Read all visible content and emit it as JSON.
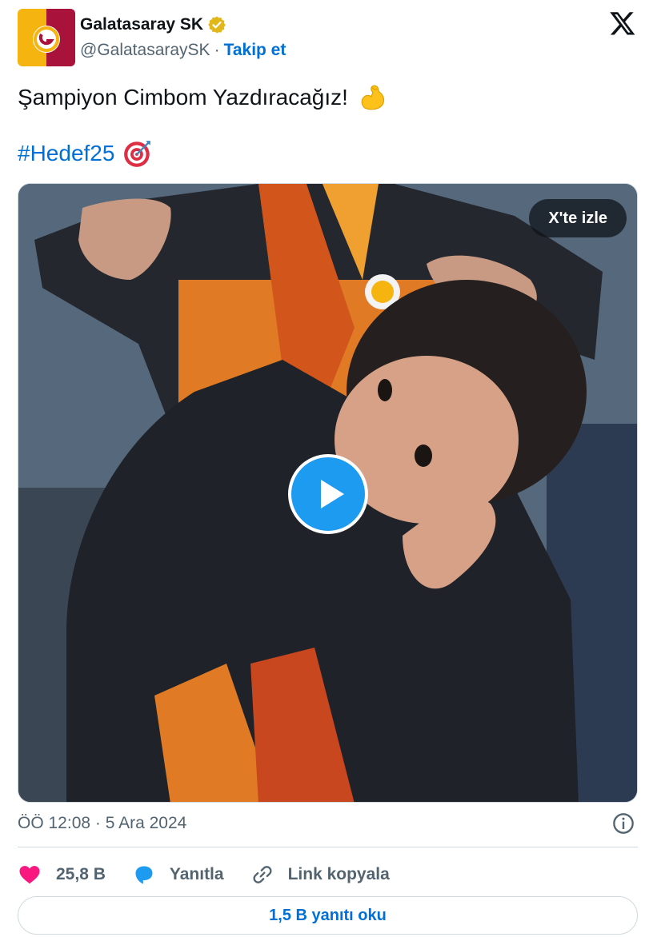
{
  "author": {
    "name": "Galatasaray SK",
    "handle": "@GalatasaraySK",
    "separator": "·",
    "follow_label": "Takip et"
  },
  "tweet": {
    "text": "Şampiyon Cimbom Yazdıracağız!",
    "hashtag": "#Hedef25"
  },
  "media": {
    "watch_label": "X'te izle"
  },
  "meta": {
    "timestamp": "ÖÖ 12:08 · 5 Ara 2024"
  },
  "actions": {
    "likes": "25,8 B",
    "reply_label": "Yanıtla",
    "copy_link_label": "Link kopyala"
  },
  "replies_button": "1,5 B yanıtı oku",
  "colors": {
    "link": "#006fd6",
    "secondary_text": "#536471",
    "like": "#f91880",
    "reply": "#1d9bf0",
    "play": "#1d9bf0"
  }
}
